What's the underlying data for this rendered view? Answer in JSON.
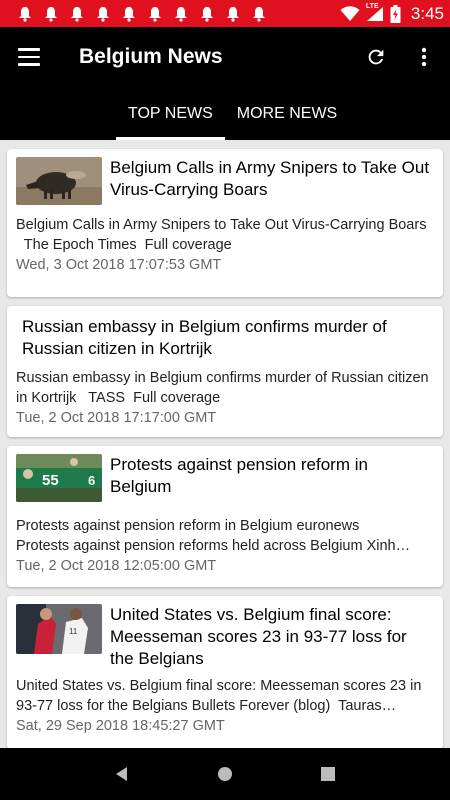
{
  "status_bar": {
    "notification_icons": [
      "bell-icon",
      "bell-icon",
      "bell-icon",
      "bell-icon",
      "bell-icon",
      "bell-icon",
      "bell-icon",
      "bell-icon",
      "bell-icon",
      "bell-icon"
    ],
    "network": "LTE",
    "time": "3:45",
    "color": "#e0101f"
  },
  "app_bar": {
    "title": "Belgium News",
    "tabs": [
      {
        "label": "TOP NEWS",
        "active": true
      },
      {
        "label": "MORE NEWS",
        "active": false
      }
    ]
  },
  "articles": [
    {
      "title": "Belgium Calls in Army Snipers to Take Out Virus-Carrying Boars",
      "summary": "Belgium Calls in Army Snipers to Take Out Virus-Carrying Boars",
      "sources": "The Epoch Times  Full coverage",
      "date": "Wed, 3 Oct 2018 17:07:53 GMT",
      "thumbnail": "wild-boar-photo"
    },
    {
      "title": "Russian embassy in Belgium confirms murder of Russian citizen in Kortrijk",
      "summary": "Russian embassy in Belgium confirms murder of Russian citizen in Kortrijk",
      "sources": "TASS  Full coverage",
      "date": "Tue, 2 Oct 2018 17:17:00 GMT",
      "thumbnail": ""
    },
    {
      "title": "Protests against pension reform in Belgium",
      "summary": "Protests against pension reform in Belgium",
      "sources": "euronews",
      "line2": "Protests against pension reforms held across Belgium  Xinh…",
      "date": "Tue, 2 Oct 2018 12:05:00 GMT",
      "thumbnail": "protest-photo"
    },
    {
      "title": "United States vs. Belgium final score: Meesseman scores 23 in 93-77 loss for the Belgians",
      "summary": "United States vs. Belgium final score: Meesseman scores 23 in 93-77 loss for the Belgians",
      "sources": "Bullets Forever (blog)  Tauras…",
      "date": "Sat, 29 Sep 2018 18:45:27 GMT",
      "thumbnail": "basketball-photo"
    }
  ]
}
